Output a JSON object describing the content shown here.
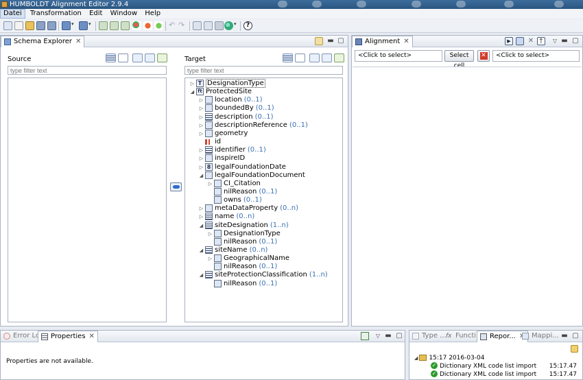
{
  "window": {
    "title": "HUMBOLDT Alignment Editor 2.9.4"
  },
  "menu": [
    "Datei",
    "Transformation",
    "Edit",
    "Window",
    "Help"
  ],
  "schema_explorer": {
    "tab": "Schema Explorer",
    "source_label": "Source",
    "target_label": "Target",
    "source_filter_placeholder": "type filter text",
    "target_filter_placeholder": "type filter text",
    "target_tree": [
      {
        "name": "DesignationType",
        "card": "",
        "depth": 0,
        "expander": "▷",
        "icon": "T"
      },
      {
        "name": "ProtectedSite",
        "card": "",
        "depth": 0,
        "expander": "◢",
        "icon": "ft"
      },
      {
        "name": "location",
        "card": "(0..1)",
        "depth": 1,
        "expander": "▷",
        "icon": "grid"
      },
      {
        "name": "boundedBy",
        "card": "(0..1)",
        "depth": 1,
        "expander": "▷",
        "icon": "grid"
      },
      {
        "name": "description",
        "card": "(0..1)",
        "depth": 1,
        "expander": "▷",
        "icon": "list"
      },
      {
        "name": "descriptionReference",
        "card": "(0..1)",
        "depth": 1,
        "expander": "▷",
        "icon": "grid"
      },
      {
        "name": "geometry",
        "card": "",
        "depth": 1,
        "expander": "▷",
        "icon": "grid"
      },
      {
        "name": "id",
        "card": "",
        "depth": 1,
        "expander": "",
        "icon": "id"
      },
      {
        "name": "identifier",
        "card": "(0..1)",
        "depth": 1,
        "expander": "▷",
        "icon": "list"
      },
      {
        "name": "inspireID",
        "card": "",
        "depth": 1,
        "expander": "▷",
        "icon": "grid"
      },
      {
        "name": "legalFoundationDate",
        "card": "",
        "depth": 1,
        "expander": "▷",
        "icon": "8"
      },
      {
        "name": "legalFoundationDocument",
        "card": "",
        "depth": 1,
        "expander": "◢",
        "icon": "grid"
      },
      {
        "name": "CI_Citation",
        "card": "",
        "depth": 2,
        "expander": "▷",
        "icon": "grid"
      },
      {
        "name": "nilReason",
        "card": "(0..1)",
        "depth": 2,
        "expander": "",
        "icon": "grid"
      },
      {
        "name": "owns",
        "card": "(0..1)",
        "depth": 2,
        "expander": "",
        "icon": "grid"
      },
      {
        "name": "metaDataProperty",
        "card": "(0..n)",
        "depth": 1,
        "expander": "▷",
        "icon": "grid"
      },
      {
        "name": "name",
        "card": "(0..n)",
        "depth": 1,
        "expander": "▷",
        "icon": "list"
      },
      {
        "name": "siteDesignation",
        "card": "(1..n)",
        "depth": 1,
        "expander": "◢",
        "icon": "list"
      },
      {
        "name": "DesignationType",
        "card": "",
        "depth": 2,
        "expander": "▷",
        "icon": "grid"
      },
      {
        "name": "nilReason",
        "card": "(0..1)",
        "depth": 2,
        "expander": "",
        "icon": "grid"
      },
      {
        "name": "siteName",
        "card": "(0..n)",
        "depth": 1,
        "expander": "◢",
        "icon": "list"
      },
      {
        "name": "GeographicalName",
        "card": "",
        "depth": 2,
        "expander": "▷",
        "icon": "grid"
      },
      {
        "name": "nilReason",
        "card": "(0..1)",
        "depth": 2,
        "expander": "",
        "icon": "grid"
      },
      {
        "name": "siteProtectionClassification",
        "card": "(1..n)",
        "depth": 1,
        "expander": "◢",
        "icon": "list"
      },
      {
        "name": "nilReason",
        "card": "(0..1)",
        "depth": 2,
        "expander": "",
        "icon": "grid"
      }
    ]
  },
  "alignment": {
    "tab": "Alignment",
    "source_select": "<Click to select>",
    "select_cell_label": "Select cell",
    "target_select": "<Click to select>"
  },
  "bottom_left": {
    "tabs": [
      "Error Log",
      "Properties"
    ],
    "message": "Properties are not available."
  },
  "bottom_right": {
    "tabs": [
      "Type ...",
      "Functi...",
      "Repor...",
      "Mappi..."
    ],
    "group": "15:17 2016-03-04",
    "reports": [
      {
        "name": "Dictionary XML code list import",
        "time": "15:17.47"
      },
      {
        "name": "Dictionary XML code list import",
        "time": "15:17.47"
      }
    ]
  },
  "colors": {
    "accent": "#3a6fb0",
    "title_bar": "#2a557f",
    "success": "#2c9a2c",
    "error": "#d23a2a"
  }
}
